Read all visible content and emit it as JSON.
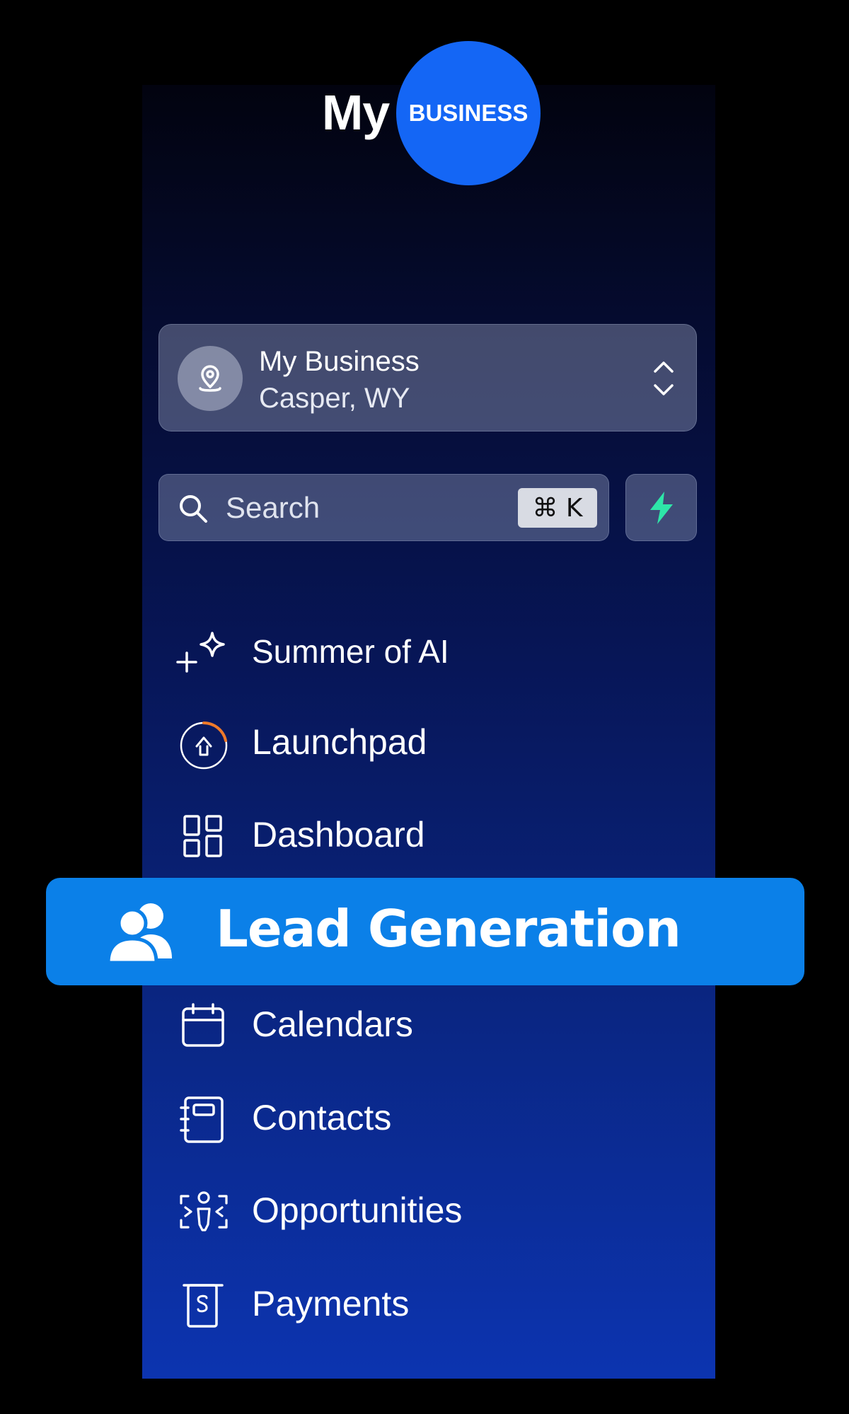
{
  "logo": {
    "word": "My",
    "badge": "BUSINESS"
  },
  "account": {
    "name": "My Business",
    "location": "Casper, WY",
    "avatar_icon": "location-pin-icon",
    "switch_icon": "chevron-up-down-icon"
  },
  "search": {
    "placeholder": "Search",
    "shortcut": "⌘ K",
    "quick_action_icon": "lightning-bolt-icon"
  },
  "nav": {
    "items": [
      {
        "label": "Summer of AI",
        "icon": "sparkles-icon"
      },
      {
        "label": "Launchpad",
        "icon": "launchpad-icon"
      },
      {
        "label": "Dashboard",
        "icon": "dashboard-grid-icon"
      },
      {
        "label": "Lead Generation",
        "icon": "users-icon",
        "highlighted": true
      },
      {
        "label": "Calendars",
        "icon": "calendar-icon"
      },
      {
        "label": "Contacts",
        "icon": "contacts-book-icon"
      },
      {
        "label": "Opportunities",
        "icon": "opportunities-icon"
      },
      {
        "label": "Payments",
        "icon": "payments-icon"
      }
    ]
  },
  "colors": {
    "background": "#000000",
    "logo_circle": "#1466f5",
    "highlight": "#0b80e8",
    "bolt": "#2ee6a8",
    "launchpad_progress": "#f07a2a"
  }
}
